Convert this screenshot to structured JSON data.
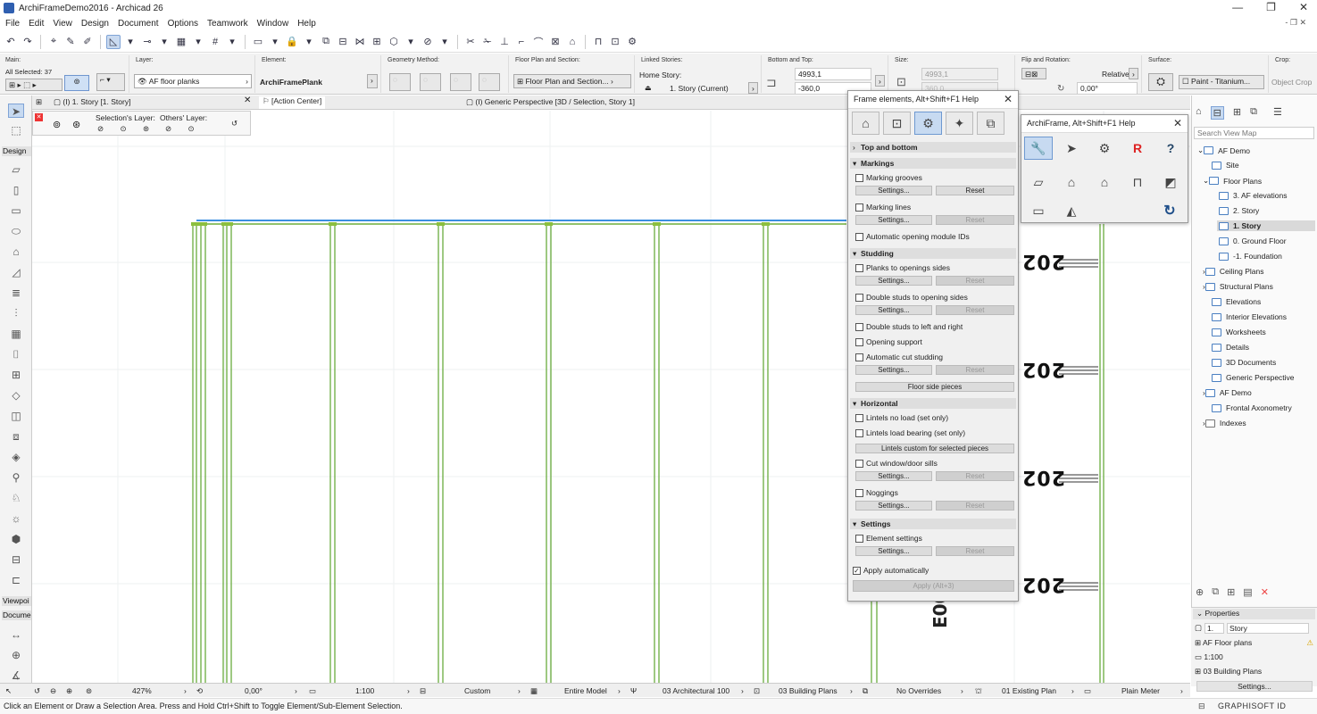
{
  "window": {
    "title": "ArchiFrameDemo2016 - Archicad 26",
    "controls": [
      "—",
      "❐",
      "✕"
    ]
  },
  "menu": [
    "File",
    "Edit",
    "View",
    "Design",
    "Document",
    "Options",
    "Teamwork",
    "Window",
    "Help"
  ],
  "menu_sub": "- ❐ ✕",
  "infobox": {
    "main_label": "Main:",
    "all_selected": "All Selected: 37",
    "layer_label": "Layer:",
    "layer_value": "AF floor planks",
    "element_label": "Element:",
    "element_value": "ArchiFramePlank",
    "geometry_label": "Geometry Method:",
    "floorplan_label": "Floor Plan and Section:",
    "floorplan_value": "Floor Plan and Section...",
    "linked_label": "Linked Stories:",
    "home_story": "Home Story:",
    "home_story_value": "1. Story (Current)",
    "bottom_top_label": "Bottom and Top:",
    "top_value": "4993,1",
    "bottom_value": "-360,0",
    "size_label": "Size:",
    "size_value1": "4993,1",
    "size_value2": "360,0",
    "flip_label": "Flip and Rotation:",
    "relative": "Relative",
    "angle_value": "0,00°",
    "surface_label": "Surface:",
    "surface_value": "Paint - Titanium...",
    "crop_label": "Crop:",
    "crop_value": "Object Crop"
  },
  "tabs": {
    "story": "(I) 1. Story [1. Story]",
    "action": "[Action Center]",
    "perspective": "(I) Generic Perspective [3D / Selection, Story 1]"
  },
  "layerbar": {
    "selection": "Selection's Layer:",
    "others": "Others' Layer:"
  },
  "toolbox": {
    "design": "Design",
    "viewpoint": "Viewpoi",
    "document": "Docume"
  },
  "markers": [
    "202",
    "202",
    "202",
    "202"
  ],
  "vertical_marker": "E002-2",
  "panel1": {
    "title": "Frame elements, Alt+Shift+F1 Help",
    "sections": {
      "top_bottom": "Top and bottom",
      "markings": "Markings",
      "studding": "Studding",
      "horizontal": "Horizontal",
      "settings": "Settings"
    },
    "items": {
      "marking_grooves": "Marking grooves",
      "marking_lines": "Marking lines",
      "auto_opening_ids": "Automatic opening module IDs",
      "planks_openings": "Planks to openings sides",
      "double_studs_opening": "Double studs to opening sides",
      "double_studs_lr": "Double studs to left and right",
      "opening_support": "Opening support",
      "auto_cut": "Automatic cut studding",
      "lintels_no_load": "Lintels no load (set only)",
      "lintels_load": "Lintels load bearing (set only)",
      "cut_sills": "Cut window/door sills",
      "noggings": "Noggings",
      "element_settings": "Element settings",
      "apply_auto": "Apply automatically"
    },
    "buttons": {
      "settings": "Settings...",
      "reset": "Reset",
      "floor_side": "Floor side pieces",
      "lintels_custom": "Lintels custom for selected pieces",
      "apply": "Apply (Alt+3)"
    }
  },
  "panel2": {
    "title": "ArchiFrame, Alt+Shift+F1 Help"
  },
  "navigator": {
    "search_placeholder": "Search View Map",
    "items": [
      "AF Demo",
      "Site",
      "Floor Plans",
      "3. AF elevations",
      "2. Story",
      "1. Story",
      "0. Ground Floor",
      "-1. Foundation",
      "Ceiling Plans",
      "Structural Plans",
      "Elevations",
      "Interior Elevations",
      "Worksheets",
      "Details",
      "3D Documents",
      "Generic Perspective",
      "AF Demo",
      "Frontal Axonometry",
      "Indexes"
    ]
  },
  "properties": {
    "header": "Properties",
    "story_num": "1.",
    "story_name": "Story",
    "layer": "AF Floor plans",
    "scale": "1:100",
    "plans": "03 Building Plans",
    "settings": "Settings..."
  },
  "status": {
    "zoom": "427%",
    "angle": "0,00°",
    "scale": "1:100",
    "custom": "Custom",
    "model": "Entire Model",
    "arch": "03 Architectural 100",
    "plans": "03 Building Plans",
    "overrides": "No Overrides",
    "existing": "01 Existing Plan",
    "meter": "Plain Meter"
  },
  "bottom": {
    "hint": "Click an Element or Draw a Selection Area. Press and Hold Ctrl+Shift to Toggle Element/Sub-Element Selection.",
    "brand": "GRAPHISOFT ID"
  }
}
